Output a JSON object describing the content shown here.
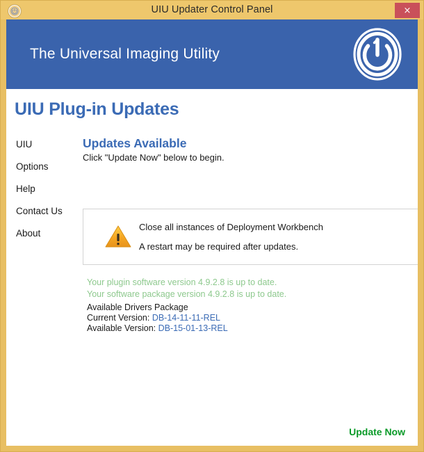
{
  "window": {
    "title": "UIU Updater Control Panel",
    "app_icon": "power-button-icon",
    "close_label": "×",
    "frame_color": "#e8bf63",
    "titlebar_color": "#eec76c",
    "close_color": "#c9505a"
  },
  "banner": {
    "title": "The Universal Imaging Utility",
    "logo": "power-one-logo",
    "background_color": "#3a63ac"
  },
  "page": {
    "title": "UIU Plug-in Updates",
    "title_color": "#3b6bb5"
  },
  "sidebar": {
    "items": [
      {
        "label": "UIU"
      },
      {
        "label": "Options"
      },
      {
        "label": "Help"
      },
      {
        "label": "Contact Us"
      },
      {
        "label": "About"
      }
    ]
  },
  "main": {
    "heading": "Updates Available",
    "subheading": "Click \"Update Now\" below to begin."
  },
  "warning": {
    "icon": "warning-triangle-icon",
    "icon_color": "#f5a623",
    "lines": [
      "Close all instances of Deployment Workbench",
      "A restart may be required after updates."
    ]
  },
  "status": {
    "ok_color": "#8ec98e",
    "value_color": "#3b6bb5",
    "ok_lines": [
      "Your plugin software version 4.9.2.8 is up to date.",
      "Your software package version 4.9.2.8 is up to date."
    ],
    "drivers_heading": "Available Drivers Package",
    "current_version_label": "Current Version:",
    "current_version_value": "DB-14-11-11-REL",
    "available_version_label": "Available Version:",
    "available_version_value": "DB-15-01-13-REL"
  },
  "footer": {
    "update_now_label": "Update Now",
    "update_now_color": "#0a9a28"
  }
}
